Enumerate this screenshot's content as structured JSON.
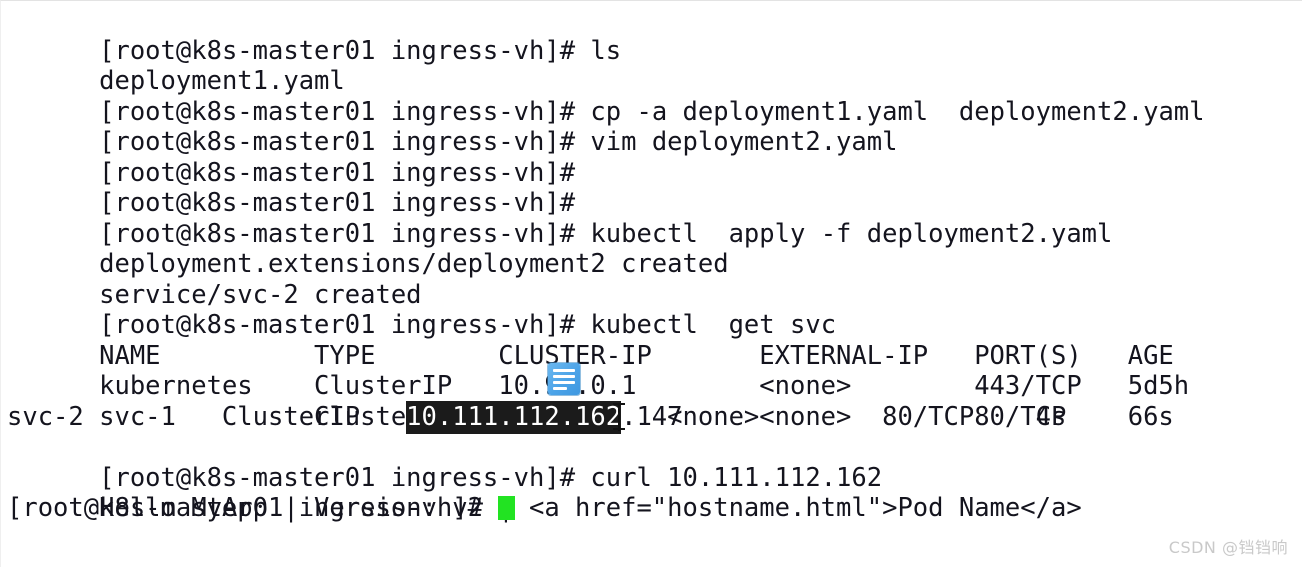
{
  "terminal": {
    "prompt": "[root@k8s-master01 ingress-vh]# ",
    "lines": [
      {
        "type": "prompt",
        "command": "ls"
      },
      {
        "type": "output",
        "text": "deployment1.yaml"
      },
      {
        "type": "prompt",
        "command": "cp -a deployment1.yaml  deployment2.yaml"
      },
      {
        "type": "prompt",
        "command": "vim deployment2.yaml"
      },
      {
        "type": "prompt",
        "command": ""
      },
      {
        "type": "prompt",
        "command": ""
      },
      {
        "type": "prompt",
        "command": "kubectl  apply -f deployment2.yaml"
      },
      {
        "type": "output",
        "text": "deployment.extensions/deployment2 created"
      },
      {
        "type": "output",
        "text": "service/svc-2 created"
      },
      {
        "type": "prompt",
        "command": "kubectl  get svc"
      },
      {
        "type": "table-header",
        "text": "NAME          TYPE        CLUSTER-IP       EXTERNAL-IP   PORT(S)   AGE"
      },
      {
        "type": "table-row",
        "text": "kubernetes    ClusterIP   10.96.0.1        <none>        443/TCP   5d5h"
      },
      {
        "type": "table-row",
        "text": "svc-1         ClusterIP   10.104.2.147     <none>        80/TCP    66s"
      },
      {
        "type": "table-row-selected",
        "pre": "svc-2         ClusterIP   ",
        "selected": "10.111.112.162",
        "post": "   <none>        80/TCP    4s"
      },
      {
        "type": "prompt",
        "command": "curl 10.111.112.162"
      },
      {
        "type": "output",
        "text": "Hello MyApp | Version: v2 | <a href=\"hostname.html\">Pod Name</a>"
      },
      {
        "type": "prompt-cursor",
        "command": ""
      }
    ],
    "table": {
      "columns": [
        "NAME",
        "TYPE",
        "CLUSTER-IP",
        "EXTERNAL-IP",
        "PORT(S)",
        "AGE"
      ],
      "rows": [
        [
          "kubernetes",
          "ClusterIP",
          "10.96.0.1",
          "<none>",
          "443/TCP",
          "5d5h"
        ],
        [
          "svc-1",
          "ClusterIP",
          "10.104.2.147",
          "<none>",
          "80/TCP",
          "66s"
        ],
        [
          "svc-2",
          "ClusterIP",
          "10.111.112.162",
          "<none>",
          "80/TCP",
          "4s"
        ]
      ],
      "selected_cell": "10.111.112.162"
    },
    "colors": {
      "background": "#ffffff",
      "foreground": "#14141e",
      "selection_background": "#1b1b1b",
      "selection_foreground": "#ffffff",
      "cursor": "#22e322",
      "copy_icon": "#4ba3e8"
    }
  },
  "overlay": {
    "copy_icon_name": "copy-document-icon"
  },
  "watermark": {
    "text": "CSDN @铛铛响"
  }
}
